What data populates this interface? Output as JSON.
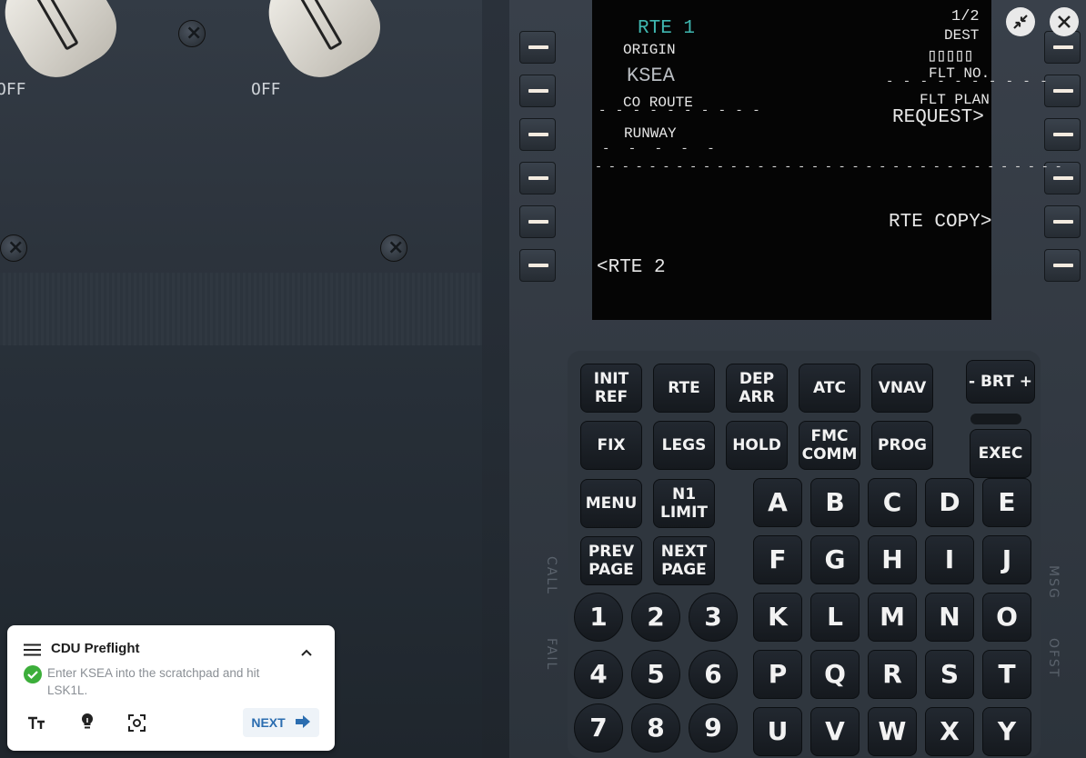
{
  "window": {
    "minimize_icon": "collapse-arrows-icon",
    "close_icon": "close-icon"
  },
  "overhead": {
    "off_label_1": "OFF",
    "off_label_2": "OFF"
  },
  "cdu_screen": {
    "title": "RTE 1",
    "page": "1/2",
    "origin_label": "ORIGIN",
    "origin_value": "KSEA",
    "dest_label": "DEST",
    "dest_boxes": "▯▯▯▯▯",
    "co_route_label": "CO  ROUTE",
    "co_route_dashes": "- - - - - - - - - -",
    "flt_no_label": "FLT NO.",
    "flt_no_dashes": "- - - - - - - - - -",
    "runway_label": "RUNWAY",
    "runway_dashes": "- - - - -",
    "flt_plan_label": "FLT PLAN",
    "request_value": "REQUEST>",
    "separator": "- - - - - - - - - - - - - - - - - - - - - - - - - - - - - - - - - - -",
    "rte_copy": "RTE COPY>",
    "rte_2": "<RTE 2"
  },
  "keypad": {
    "function_keys": [
      "INIT\nREF",
      "RTE",
      "DEP\nARR",
      "ATC",
      "VNAV",
      "FIX",
      "LEGS",
      "HOLD",
      "FMC\nCOMM",
      "PROG",
      "MENU",
      "N1\nLIMIT",
      "PREV\nPAGE",
      "NEXT\nPAGE"
    ],
    "brt": "- BRT +",
    "exec": "EXEC",
    "alpha_keys": [
      "A",
      "B",
      "C",
      "D",
      "E",
      "F",
      "G",
      "H",
      "I",
      "J",
      "K",
      "L",
      "M",
      "N",
      "O",
      "P",
      "Q",
      "R",
      "S",
      "T",
      "U",
      "V",
      "W",
      "X",
      "Y"
    ],
    "numeric_keys": [
      "1",
      "2",
      "3",
      "4",
      "5",
      "6",
      "7",
      "8",
      "9"
    ],
    "side_labels": {
      "call": "CALL",
      "fail": "FAIL",
      "msg": "MSG",
      "ofst": "OFST"
    }
  },
  "tutorial": {
    "menu_icon": "hamburger-menu-icon",
    "title": "CDU Preflight",
    "collapse_icon": "chevron-up-icon",
    "status_icon": "check-circle-icon",
    "instruction": "Enter KSEA into the scratchpad and hit LSK1L.",
    "tools": [
      "text-size-icon",
      "hint-bulb-icon",
      "focus-view-icon"
    ],
    "next_label": "NEXT",
    "next_icon": "arrow-right-icon"
  }
}
